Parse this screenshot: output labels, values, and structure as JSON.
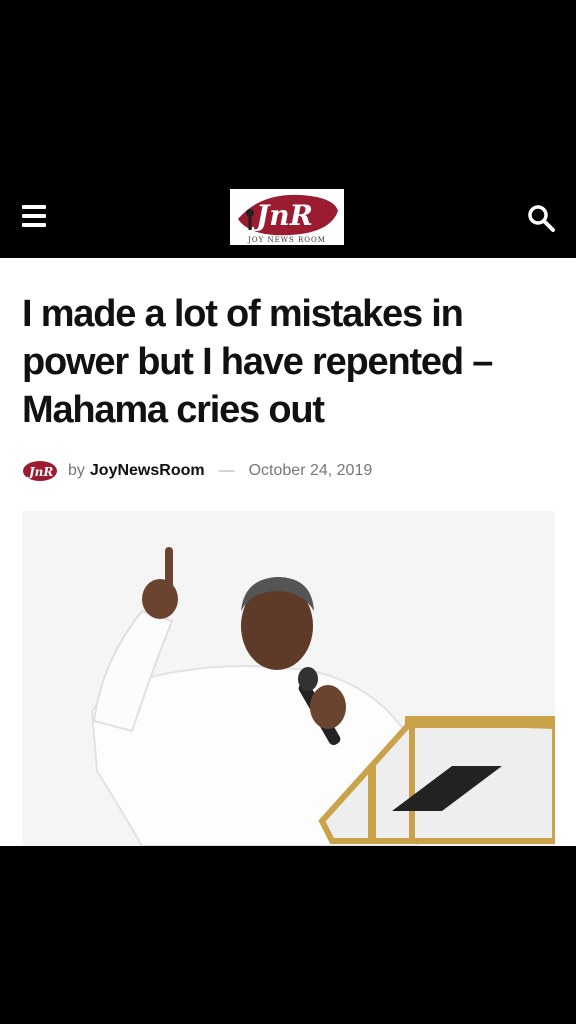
{
  "header": {
    "menu_icon": "hamburger-menu-icon",
    "logo_text": "JnR",
    "logo_tagline": "JOY NEWS ROOM",
    "search_icon": "search-icon",
    "brand_color": "#9b1b30"
  },
  "article": {
    "headline": "I made a lot of mistakes in power but I have repented – Mahama cries out",
    "byline_prefix": "by",
    "author": "JoyNewsRoom",
    "separator": "—",
    "date": "October 24, 2019",
    "image_alt_icon": "photo-icon"
  }
}
